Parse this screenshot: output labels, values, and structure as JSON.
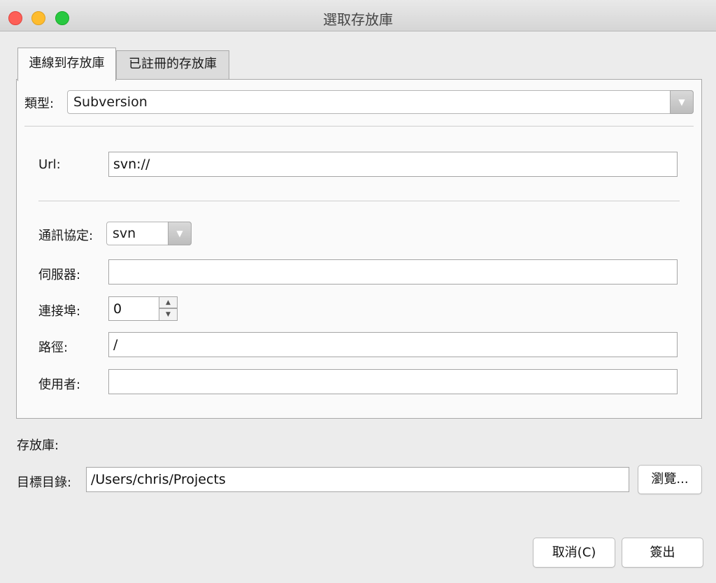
{
  "window": {
    "title": "選取存放庫"
  },
  "tabs": [
    {
      "label": "連線到存放庫"
    },
    {
      "label": "已註冊的存放庫"
    }
  ],
  "form": {
    "type_label": "類型:",
    "type_value": "Subversion",
    "url_label": "Url:",
    "url_value": "svn://",
    "protocol_label": "通訊協定:",
    "protocol_value": "svn",
    "server_label": "伺服器:",
    "server_value": "",
    "port_label": "連接埠:",
    "port_value": "0",
    "path_label": "路徑:",
    "path_value": "/",
    "user_label": "使用者:",
    "user_value": ""
  },
  "repository_label": "存放庫:",
  "target": {
    "label": "目標目錄:",
    "value": "/Users/chris/Projects",
    "browse_label": "瀏覽..."
  },
  "buttons": {
    "cancel_label": "取消(C)",
    "checkout_label": "簽出"
  },
  "colors": {
    "close": "#fe5f57",
    "minimize": "#febc2e",
    "zoom": "#28c840"
  }
}
